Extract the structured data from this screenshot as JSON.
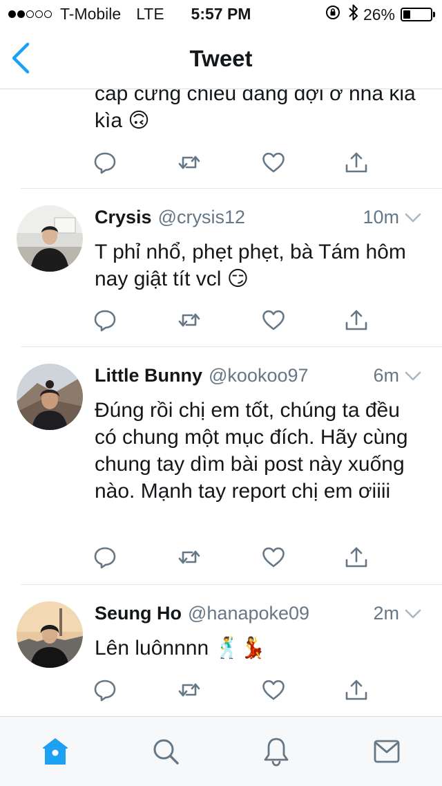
{
  "status_bar": {
    "signal_dots": [
      true,
      true,
      false,
      false,
      false
    ],
    "carrier": "T-Mobile",
    "network": "LTE",
    "time": "5:57 PM",
    "battery_percent_label": "26%",
    "battery_level": 0.26,
    "icons": [
      "orientation-lock-icon",
      "bluetooth-icon",
      "battery-icon"
    ]
  },
  "nav": {
    "title": "Tweet",
    "back_icon": "chevron-left-icon"
  },
  "colors": {
    "accent": "#1da1f2",
    "text": "#14171a",
    "secondary_text": "#657786",
    "icon_gray": "#657786",
    "divider": "#e1e8ed"
  },
  "tweets": [
    {
      "text": "cap cưng chiều đang đợi ở nha kia kìa 🙃",
      "partial": true
    },
    {
      "name": "Crysis",
      "handle": "@crysis12",
      "time": "10m",
      "text": "T phỉ nhổ, phẹt phẹt, bà Tám hôm nay giật tít vcl 😏"
    },
    {
      "name": "Little Bunny",
      "handle": "@kookoo97",
      "time": "6m",
      "text": "Đúng rồi chị em tốt, chúng ta đều có chung một mục đích. Hãy cùng chung tay dìm bài post này xuống nào. Mạnh tay report chị em ơiiii"
    },
    {
      "name": "Seung Ho",
      "handle": "@hanapoke09",
      "time": "2m",
      "text": "Lên luônnnn 🕺💃"
    }
  ],
  "tweet_actions": [
    "reply-icon",
    "retweet-icon",
    "like-icon",
    "share-icon"
  ],
  "tab_bar": {
    "tabs": [
      "home-icon",
      "search-icon",
      "notifications-icon",
      "messages-icon"
    ],
    "active_tab": "home-icon"
  }
}
